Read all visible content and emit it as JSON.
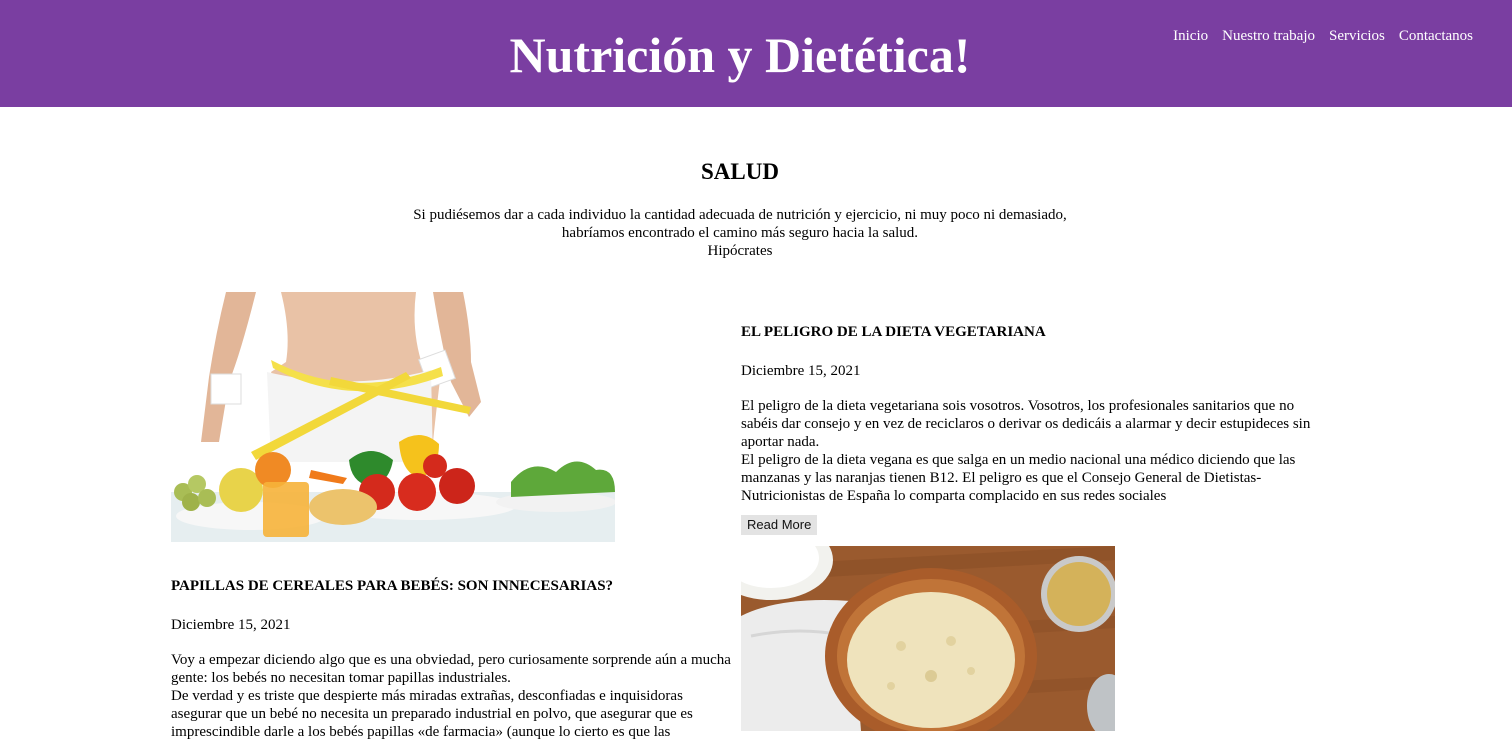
{
  "header": {
    "title": "Nutrición y Dietética!",
    "nav": [
      "Inicio",
      "Nuestro trabajo",
      "Servicios",
      "Contactanos"
    ]
  },
  "hero": {
    "title": "SALUD",
    "quote_line1": "Si pudiésemos dar a cada individuo la cantidad adecuada de nutrición y ejercicio, ni muy poco ni demasiado,",
    "quote_line2": "habríamos encontrado el camino más seguro hacia la salud.",
    "quote_author": "Hipócrates"
  },
  "articles": [
    {
      "title": "EL PELIGRO DE LA DIETA VEGETARIANA",
      "date": "Diciembre 15, 2021",
      "paragraph1": "El peligro de la dieta vegetariana sois vosotros. Vosotros, los profesionales sanitarios que no sabéis dar consejo y en vez de reciclaros o derivar os dedicáis a alarmar y decir estupideces sin aportar nada.",
      "paragraph2": "El peligro de la dieta vegana es que salga en un medio nacional una médico diciendo que las manzanas y las naranjas tienen B12. El peligro es que el Consejo General de Dietistas-Nutricionistas de España lo comparta complacido en sus redes sociales",
      "read_more": "Read More"
    },
    {
      "title": "PAPILLAS DE CEREALES PARA BEBÉS: SON INNECESARIAS?",
      "date": "Diciembre 15, 2021",
      "paragraph1": "Voy a empezar diciendo algo que es una obviedad, pero curiosamente sorprende aún a mucha gente: los bebés no necesitan tomar papillas industriales.",
      "paragraph2": "De verdad y es triste que despierte más miradas extrañas, desconfiadas e inquisidoras asegurar que un bebé no necesita un preparado industrial en polvo, que asegurar que es imprescindible darle a los bebés papillas «de farmacia» (aunque lo cierto es que las"
    }
  ],
  "colors": {
    "header_bg": "#7a3ea1",
    "header_text": "#ffffff",
    "button_bg": "#e3e3e3"
  }
}
